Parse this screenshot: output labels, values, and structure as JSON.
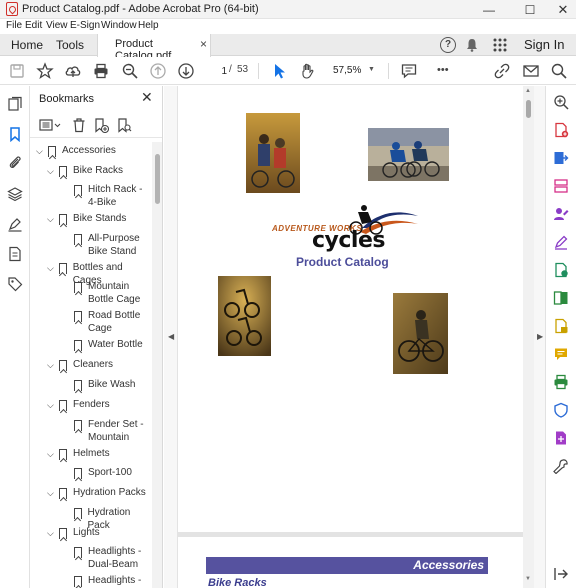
{
  "window": {
    "title": "Product Catalog.pdf - Adobe Acrobat Pro (64-bit)",
    "minimize": "—",
    "maximize": "☐",
    "close": "✕"
  },
  "menu": [
    "File",
    "Edit",
    "View",
    "E-Sign",
    "Window",
    "Help"
  ],
  "tabs": {
    "home": "Home",
    "tools": "Tools",
    "document": "Product Catalog.pdf",
    "close": "×",
    "help": "?",
    "sign_in": "Sign In"
  },
  "toolbar": {
    "current_page": "1",
    "page_separator": "/",
    "total_pages": "53",
    "zoom": "57,5%",
    "more": "•••",
    "icons": [
      "save-icon",
      "star-icon",
      "upload-icon",
      "print-icon",
      "zoom-out-icon",
      "page-up-icon",
      "page-down-icon",
      "select-arrow-icon",
      "hand-icon",
      "comment-icon",
      "link-icon",
      "mail-icon",
      "search-icon"
    ]
  },
  "bookmarks": {
    "title": "Bookmarks",
    "close": "✕",
    "items": [
      {
        "label": "Accessories",
        "level": 0,
        "expanded": true
      },
      {
        "label": "Bike Racks",
        "level": 1,
        "expanded": true
      },
      {
        "label": "Hitch Rack -\n4-Bike",
        "level": 2
      },
      {
        "label": "Bike Stands",
        "level": 1,
        "expanded": true
      },
      {
        "label": "All-Purpose\nBike Stand",
        "level": 2
      },
      {
        "label": "Bottles and Cages",
        "level": 1,
        "expanded": true
      },
      {
        "label": "Mountain\nBottle Cage",
        "level": 2
      },
      {
        "label": "Road Bottle\nCage",
        "level": 2
      },
      {
        "label": "Water Bottle",
        "level": 2
      },
      {
        "label": "Cleaners",
        "level": 1,
        "expanded": true
      },
      {
        "label": "Bike Wash",
        "level": 2
      },
      {
        "label": "Fenders",
        "level": 1,
        "expanded": true
      },
      {
        "label": "Fender Set -\nMountain",
        "level": 2
      },
      {
        "label": "Helmets",
        "level": 1,
        "expanded": true
      },
      {
        "label": "Sport-100",
        "level": 2
      },
      {
        "label": "Hydration Packs",
        "level": 1,
        "expanded": true
      },
      {
        "label": "Hydration Pack",
        "level": 2
      },
      {
        "label": "Lights",
        "level": 1,
        "expanded": true
      },
      {
        "label": "Headlights -\nDual-Beam",
        "level": 2
      },
      {
        "label": "Headlights -",
        "level": 2
      }
    ]
  },
  "document": {
    "logo_tagline": "ADVENTURE WORKS",
    "logo_name": "cycles",
    "catalog_title": "Product Catalog",
    "section_header": "Accessories",
    "subsection": "Bike Racks"
  },
  "colors": {
    "accent_blue": "#1473e6",
    "catalog_purple": "#4c4d9a",
    "section_bar": "#56529f",
    "logo_orange": "#b8581b"
  }
}
